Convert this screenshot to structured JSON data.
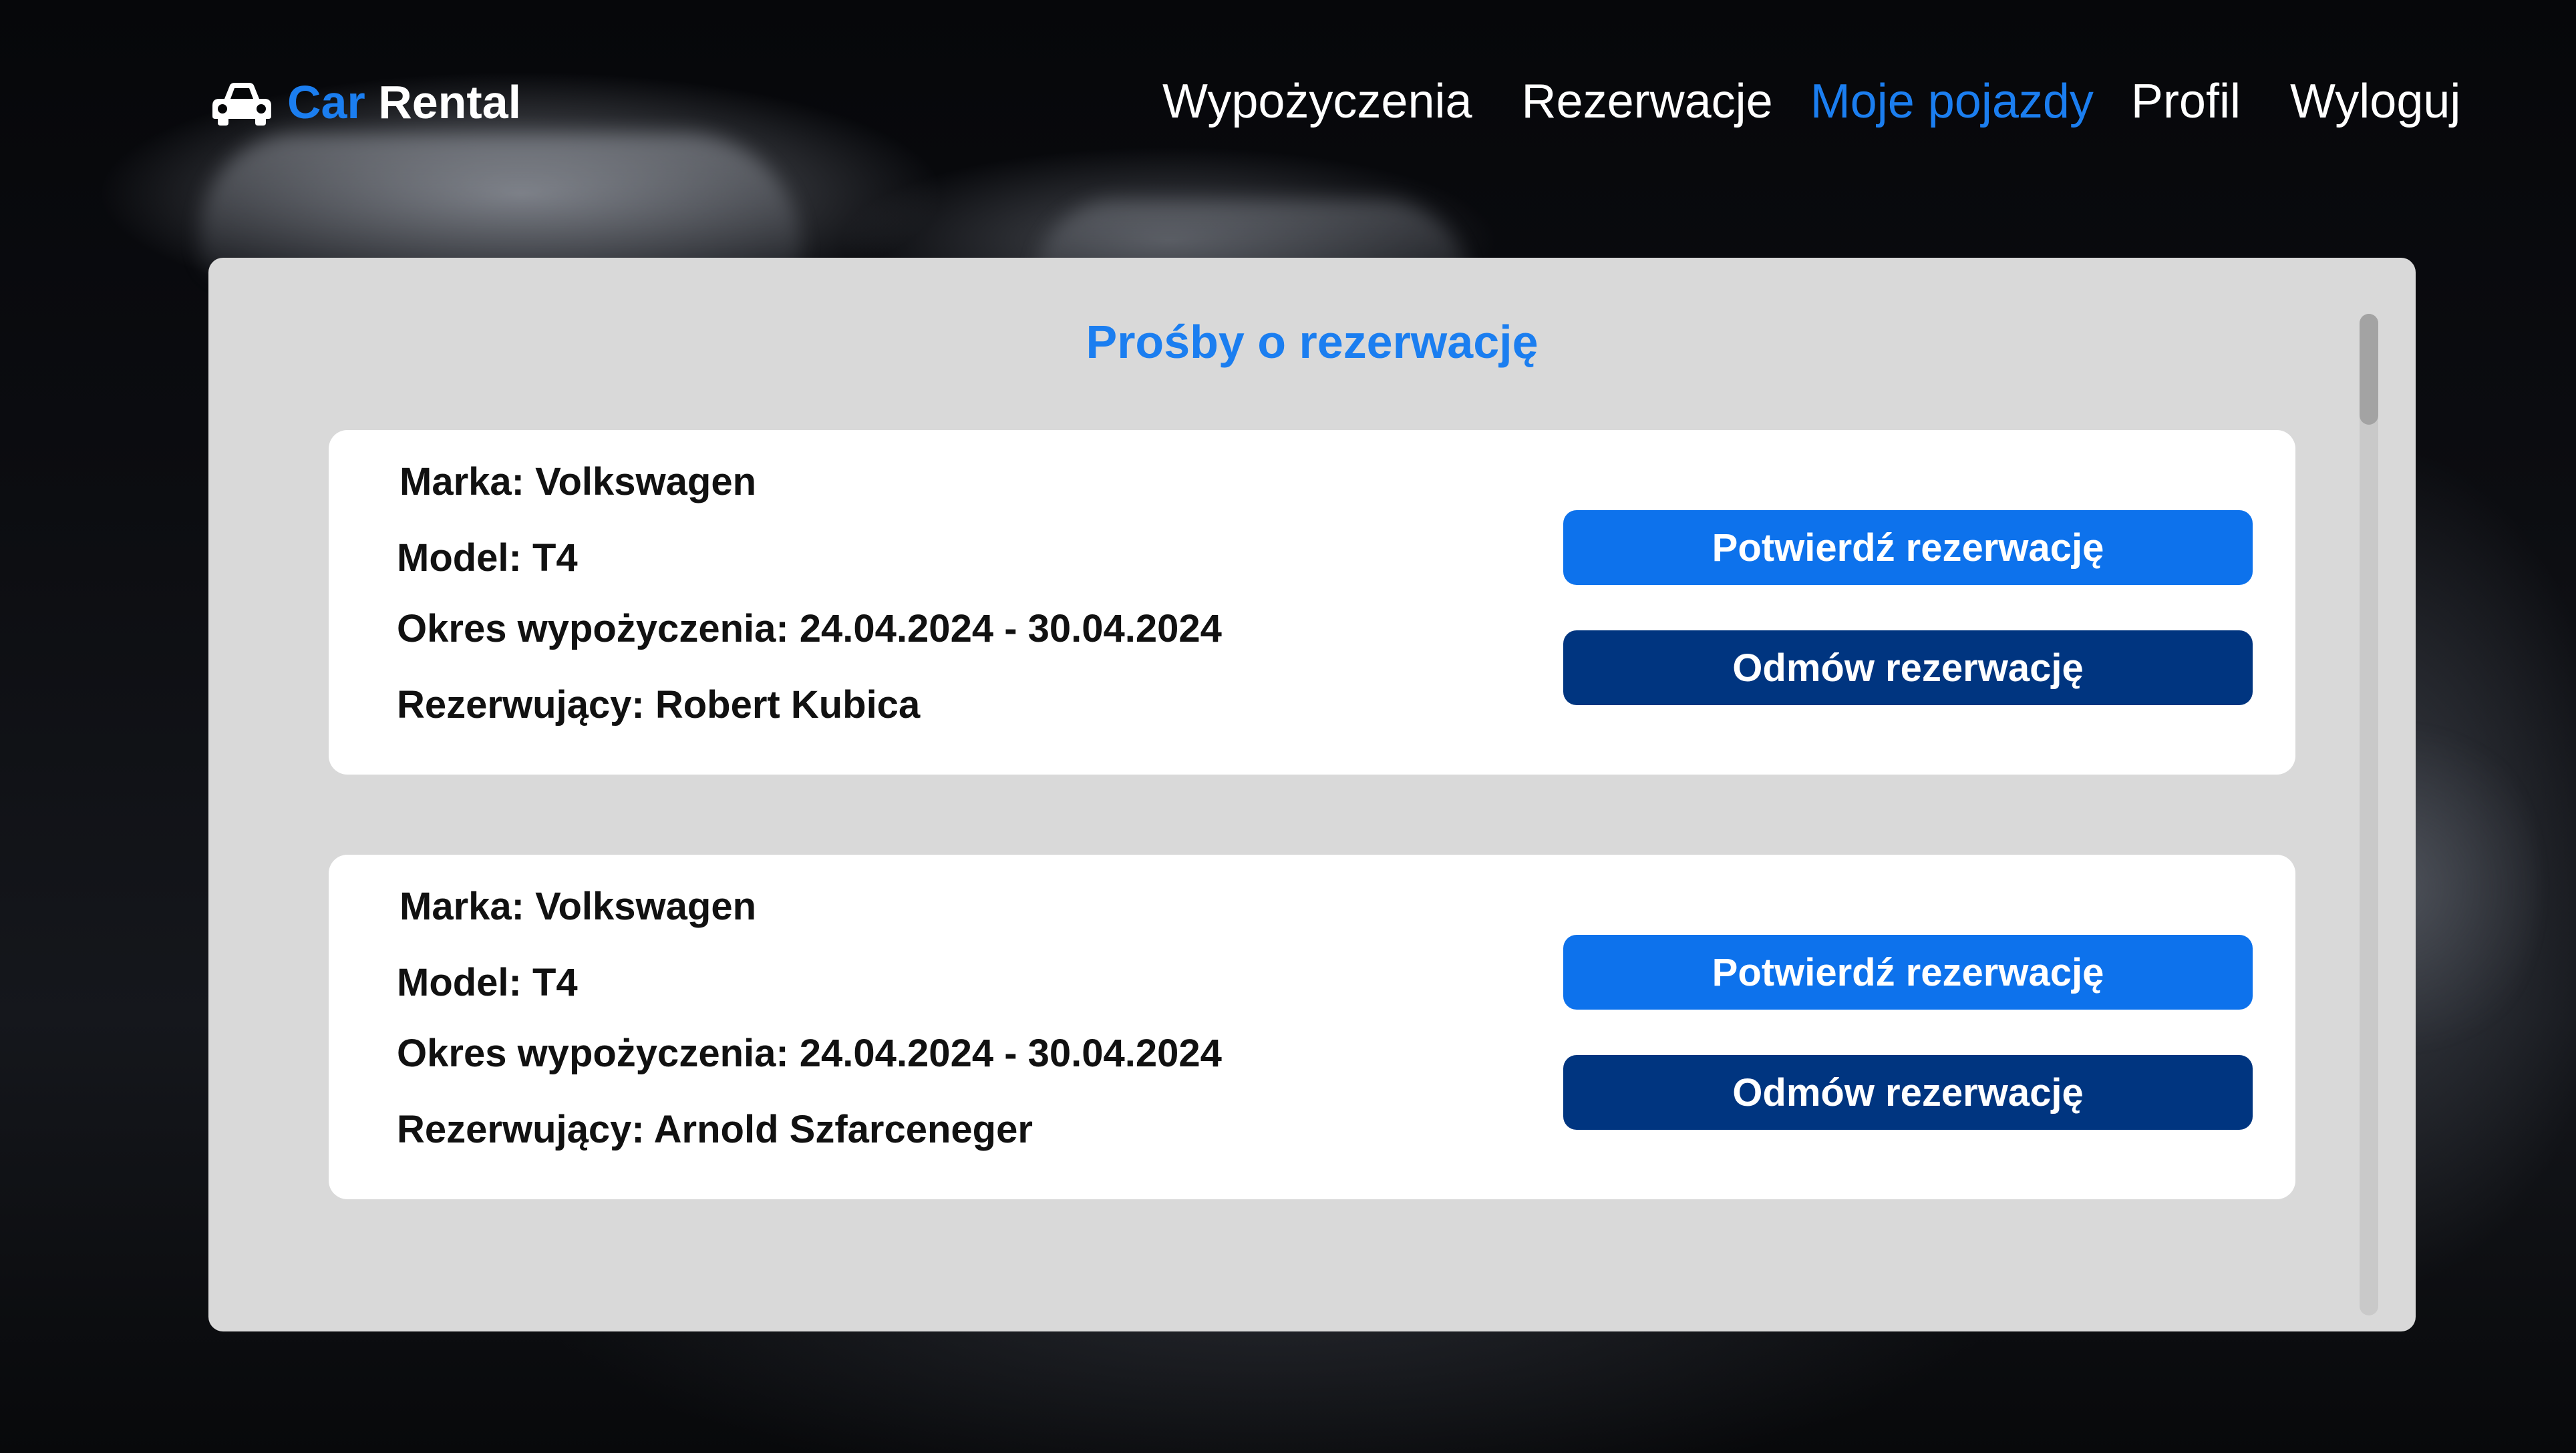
{
  "brand": {
    "name_accent": "Car",
    "name_rest": "Rental",
    "icon": "car-icon"
  },
  "nav": [
    {
      "label": "Wypożyczenia",
      "active": false
    },
    {
      "label": "Rezerwacje",
      "active": false
    },
    {
      "label": "Moje pojazdy",
      "active": true
    },
    {
      "label": "Profil",
      "active": false
    },
    {
      "label": "Wyloguj",
      "active": false
    }
  ],
  "colors": {
    "accent": "#1b7ef0",
    "confirm_button": "#0d72ec",
    "reject_button": "#003580",
    "panel_bg": "#d9d9d9",
    "card_bg": "#ffffff"
  },
  "page": {
    "title": "Prośby o rezerwację"
  },
  "requests": [
    {
      "brand": "Marka: Volkswagen",
      "model": "Model: T4",
      "period": "Okres wypożyczenia: 24.04.2024 - 30.04.2024",
      "person": "Rezerwujący: Robert Kubica",
      "confirm_label": "Potwierdź rezerwację",
      "reject_label": "Odmów rezerwację"
    },
    {
      "brand": "Marka: Volkswagen",
      "model": "Model: T4",
      "period": "Okres wypożyczenia: 24.04.2024 - 30.04.2024",
      "person": "Rezerwujący: Arnold Szfarceneger",
      "confirm_label": "Potwierdź rezerwację",
      "reject_label": "Odmów rezerwację"
    }
  ]
}
